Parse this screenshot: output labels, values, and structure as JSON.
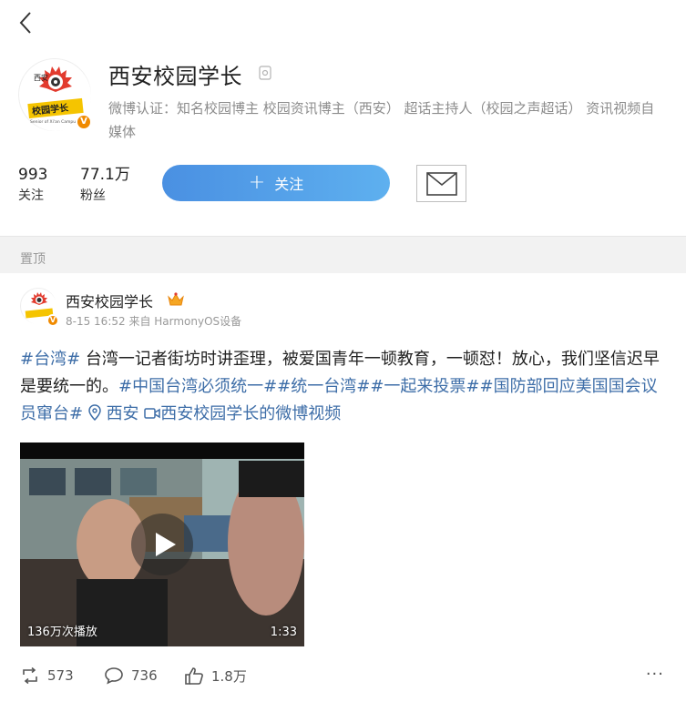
{
  "profile": {
    "name": "西安校园学长",
    "avatar_text_top": "西安",
    "avatar_text_main": "校园学长",
    "avatar_text_sub": "Senior of Xi'an Campus",
    "verified_badge": "V",
    "verify_text": "微博认证：知名校园博主 校园资讯博主（西安） 超话主持人（校园之声超话） 资讯视频自媒体",
    "following_count": "993",
    "following_label": "关注",
    "followers_count": "77.1万",
    "followers_label": "粉丝",
    "follow_button_icon": "+",
    "follow_button_label": "关注"
  },
  "pinned_label": "置顶",
  "post": {
    "author": "西安校园学长",
    "meta": "8-15 16:52 来自 HarmonyOS设备",
    "topic1": "#台湾#",
    "text_body": " 台湾一记者街坊时讲歪理，被爱国青年一顿教育，一顿怼！放心，我们坚信迟早是要统一的。",
    "topic2": "#中国台湾必须统一#",
    "topic3": "#统一台湾#",
    "topic4": "#一起来投票#",
    "topic5": "#国防部回应美国国会议员窜台#",
    "location": "西安",
    "video_link": "西安校园学长的微博视频",
    "video": {
      "views": "136万次播放",
      "duration": "1:33"
    },
    "reposts": "573",
    "comments": "736",
    "likes": "1.8万",
    "more": "···"
  },
  "colors": {
    "accent": "#4a90e2",
    "link": "#3e6ea8",
    "badge": "#f08a00"
  }
}
